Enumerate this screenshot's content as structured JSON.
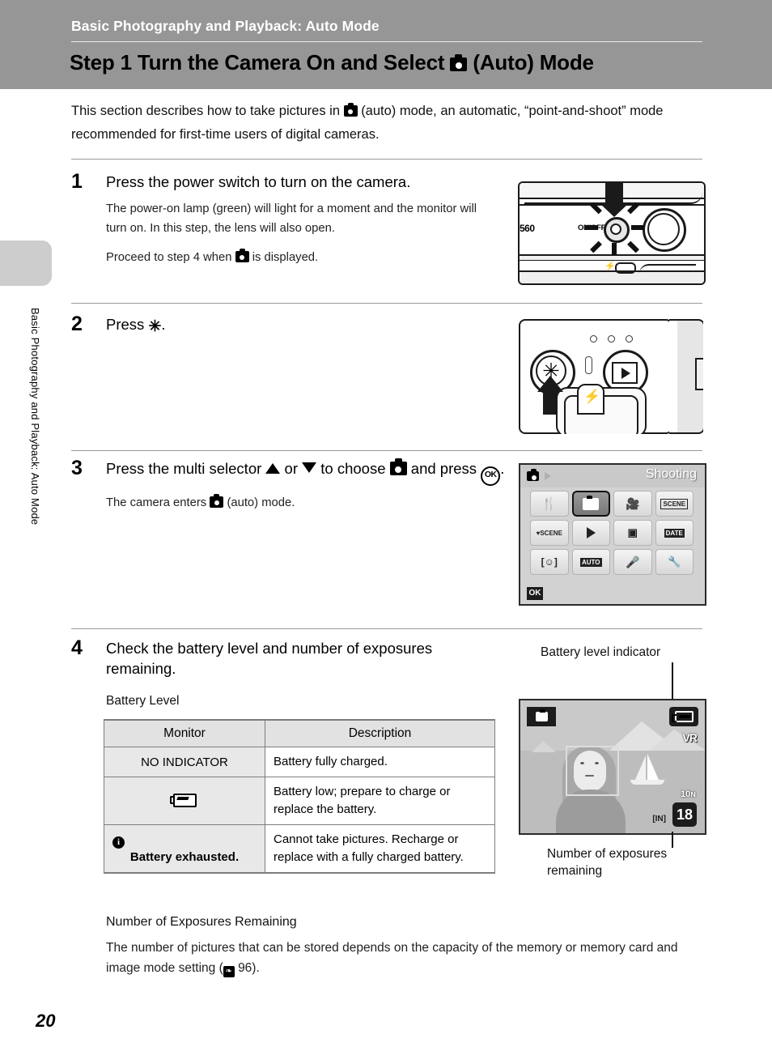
{
  "header": {
    "chapter_title": "Basic Photography and Playback: Auto Mode",
    "step_title_before": "Step 1 Turn the Camera On and Select",
    "step_title_after": "(Auto) Mode"
  },
  "sidebar": {
    "vertical_label": "Basic Photography and Playback: Auto Mode",
    "page_number": "20"
  },
  "intro": {
    "line1_a": "This section describes how to take pictures in",
    "line1_b": "(auto) mode, an automatic,",
    "line2": "“point-and-shoot” mode recommended for first-time users of digital cameras."
  },
  "steps": [
    {
      "number": "1",
      "heading": "Press the power switch to turn on the camera.",
      "body1": "The power-on lamp (green) will light for a moment and the monitor will turn on. In this step, the lens will also open.",
      "body2_a": "Proceed to step 4 when",
      "body2_b": "is displayed."
    },
    {
      "number": "2",
      "heading_a": "Press",
      "heading_b": "."
    },
    {
      "number": "3",
      "heading_a": "Press the multi selector",
      "heading_or": "or",
      "heading_b": "to choose",
      "heading_c": "and press",
      "heading_d": ".",
      "body_a": "The camera enters",
      "body_b": "(auto) mode."
    },
    {
      "number": "4",
      "heading": "Check the battery level and number of exposures remaining.",
      "section_label": "Battery Level"
    }
  ],
  "battery_table": {
    "headers": [
      "Monitor",
      "Description"
    ],
    "rows": [
      {
        "monitor_text": "NO INDICATOR",
        "monitor_icon": "",
        "description": "Battery fully charged."
      },
      {
        "monitor_text": "",
        "monitor_icon": "battery-low-icon",
        "description": "Battery low; prepare to charge or replace the battery."
      },
      {
        "monitor_text": "Battery exhausted.",
        "monitor_icon": "info-icon",
        "description": "Cannot take pictures. Recharge or replace with a fully charged battery."
      }
    ]
  },
  "exposures_section": {
    "label": "Number of Exposures Remaining",
    "body_a": "The number of pictures that can be stored depends on the capacity of the memory or memory card and image mode setting (",
    "body_ref": "96)."
  },
  "figures": {
    "camera_top": {
      "model_label": "560",
      "power_label": "ON/OFF",
      "flash_label": "flash-indicator-icon"
    },
    "camera_back": {
      "mode_button": "asterisk-mode-button",
      "playback_button": "playback-button",
      "flash_button": "flash-button"
    },
    "shooting_menu": {
      "title": "Shooting",
      "ok_label": "OK",
      "icons": [
        "restaurant-food-icon",
        "auto-camera-icon",
        "movie-icon",
        "scene-text-icon",
        "scene-heart-icon",
        "playback-icon",
        "movie-edit-icon",
        "date-icon",
        "smile-face-icon",
        "auto-text-icon",
        "microphone-icon",
        "setup-wrench-icon"
      ],
      "selected_index": 1
    },
    "lcd_monitor": {
      "caption_top": "Battery level indicator",
      "caption_bottom": "Number of exposures remaining",
      "mode_icon": "camera-auto-icon",
      "battery_icon": "battery-low-icon",
      "vr_label": "VR",
      "image_size_label": "10ɴ",
      "memory_label": "IN",
      "exposures_remaining": "18"
    }
  }
}
